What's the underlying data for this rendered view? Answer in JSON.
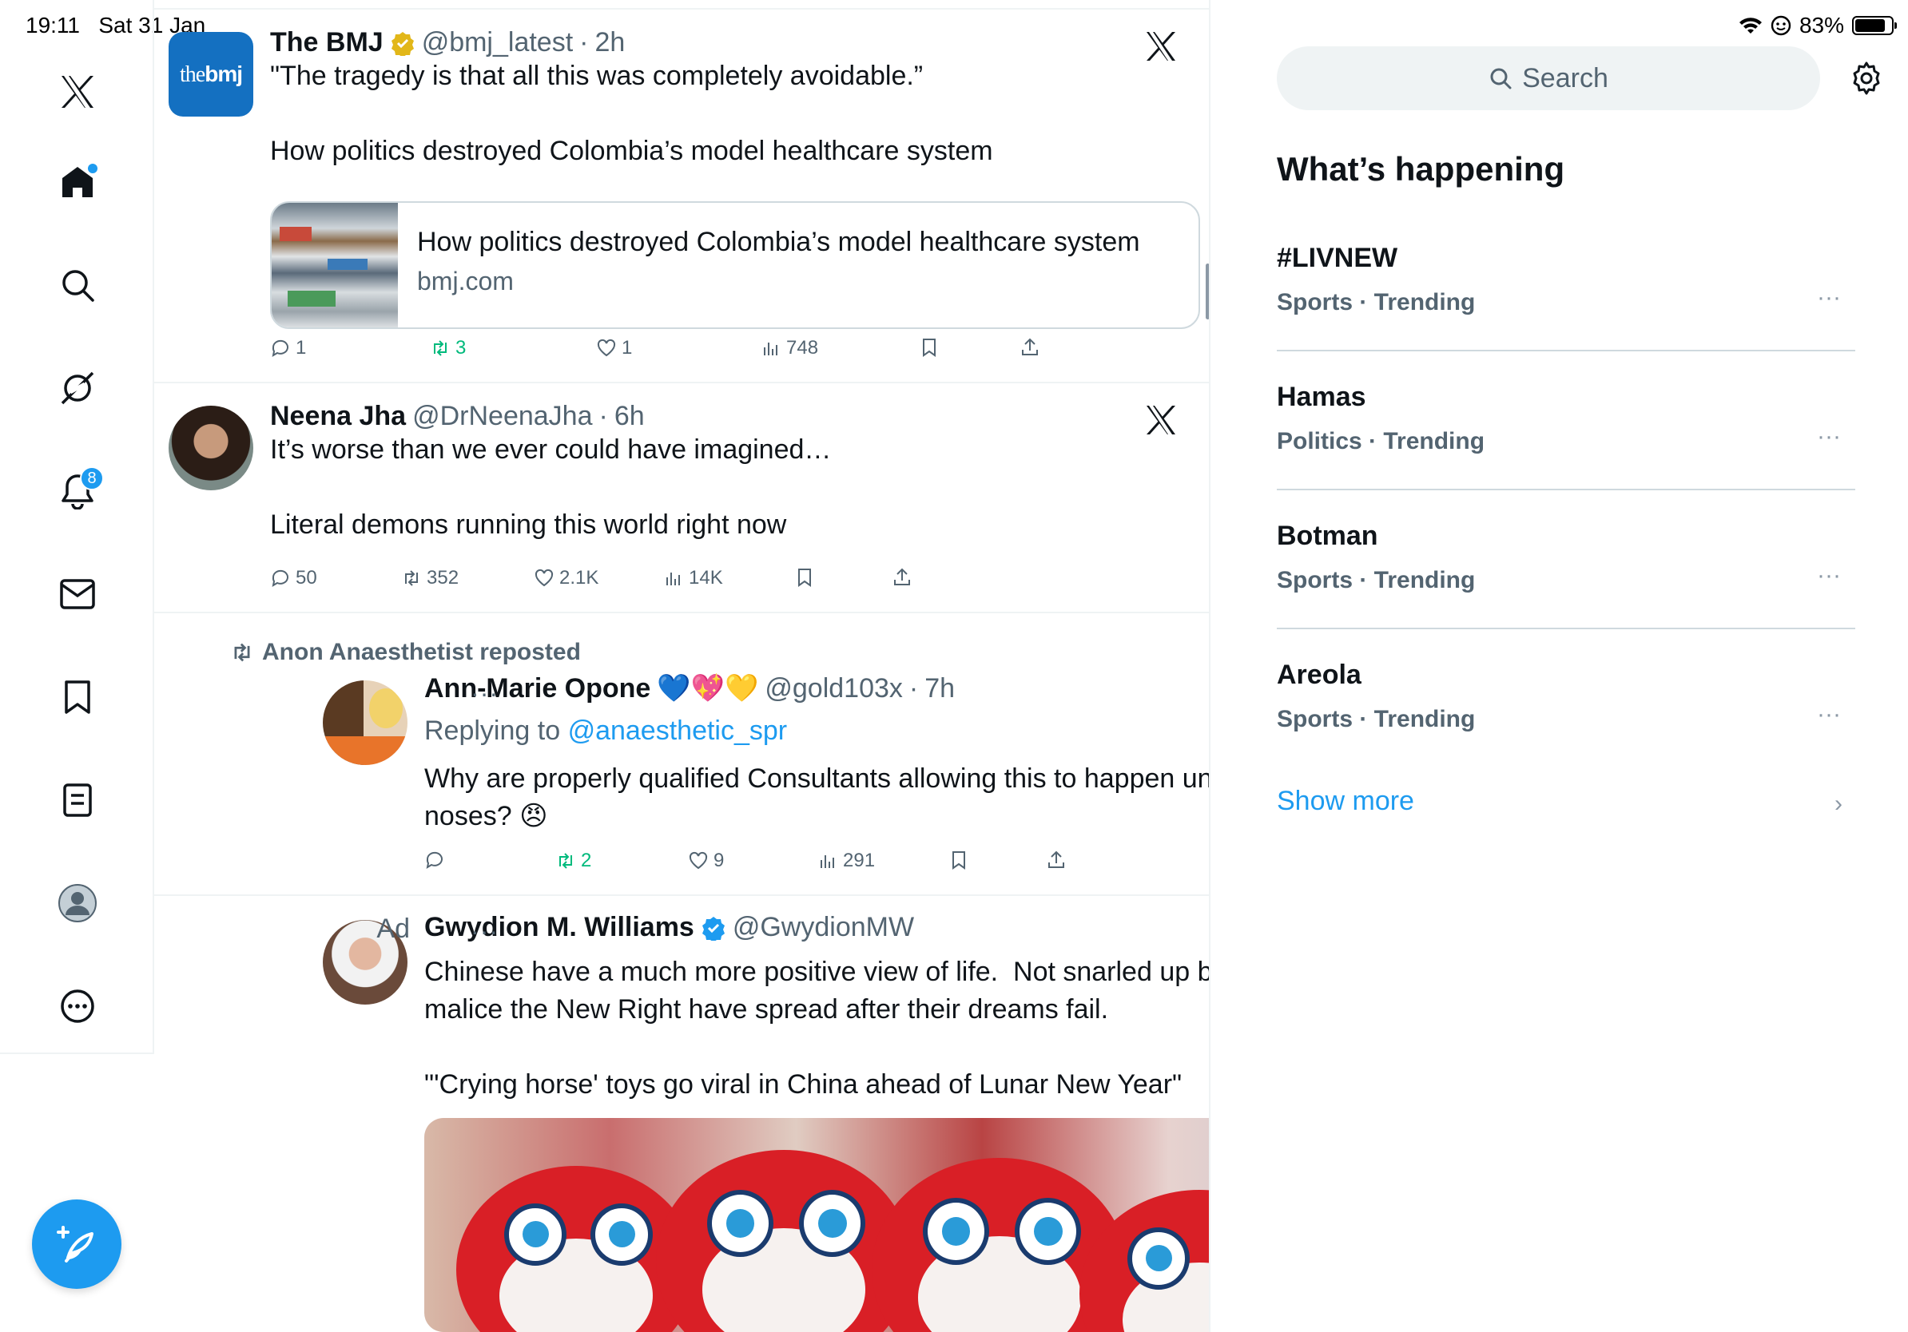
{
  "status_bar": {
    "time": "19:11",
    "date": "Sat 31 Jan",
    "battery": "83%",
    "battery_level": 0.83
  },
  "nav": {
    "items": [
      "x-logo",
      "home",
      "explore",
      "grok",
      "notifications",
      "messages",
      "bookmarks",
      "lists",
      "profile",
      "more"
    ],
    "notifications_badge": "8",
    "compose_label": "Post"
  },
  "tweets": [
    {
      "name": "The BMJ",
      "verified": "gold",
      "handle": "@bmj_latest",
      "time": "2h",
      "avatar_text": "the",
      "avatar_bold": "bmj",
      "text": "\"The tragedy is that all this was completely avoidable.”\n\nHow politics destroyed Colombia’s model healthcare system",
      "card_title": "How politics destroyed Colombia’s model healthcare system",
      "card_domain": "bmj.com",
      "replies": "1",
      "reposts": "3",
      "likes": "1",
      "views": "748"
    },
    {
      "name": "Neena Jha",
      "handle": "@DrNeenaJha",
      "time": "6h",
      "text": "It’s worse than we ever could have imagined…\n\nLiteral demons running this world right now",
      "replies": "50",
      "reposts": "352",
      "likes": "2.1K",
      "views": "14K"
    },
    {
      "repost_by": "Anon Anaesthetist reposted",
      "name": "Ann-Marie Opone",
      "emojis": "💙💖💛",
      "handle": "@gold103x",
      "time": "7h",
      "reply_prefix": "Replying to",
      "reply_to": "@anaesthetic_spr",
      "text": "Why are properly qualified Consultants allowing this to happen under their\nnoses? 😠",
      "replies": "",
      "reposts": "2",
      "likes": "9",
      "views": "291"
    },
    {
      "name": "Gwydion M. Williams",
      "verified": "blue",
      "handle": "@GwydionMW",
      "ad_label": "Ad",
      "text": "Chinese have a much more positive view of life.  Not snarled up by the\nmalice the New Right have spread after their dreams fail.\n\n\"'Crying horse' toys go viral in China ahead of Lunar New Year\""
    }
  ],
  "sidebar": {
    "search_placeholder": "Search",
    "title": "What’s happening",
    "trends": [
      {
        "name": "#LIVNEW",
        "context": "Sports · Trending"
      },
      {
        "name": "Hamas",
        "context": "Politics · Trending"
      },
      {
        "name": "Botman",
        "context": "Sports · Trending"
      },
      {
        "name": "Areola",
        "context": "Sports · Trending"
      }
    ],
    "show_more": "Show more"
  },
  "colors": {
    "accent": "#1d9bf0",
    "repost_green": "#00ba7c",
    "muted": "#536471",
    "border": "#eff3f4"
  }
}
